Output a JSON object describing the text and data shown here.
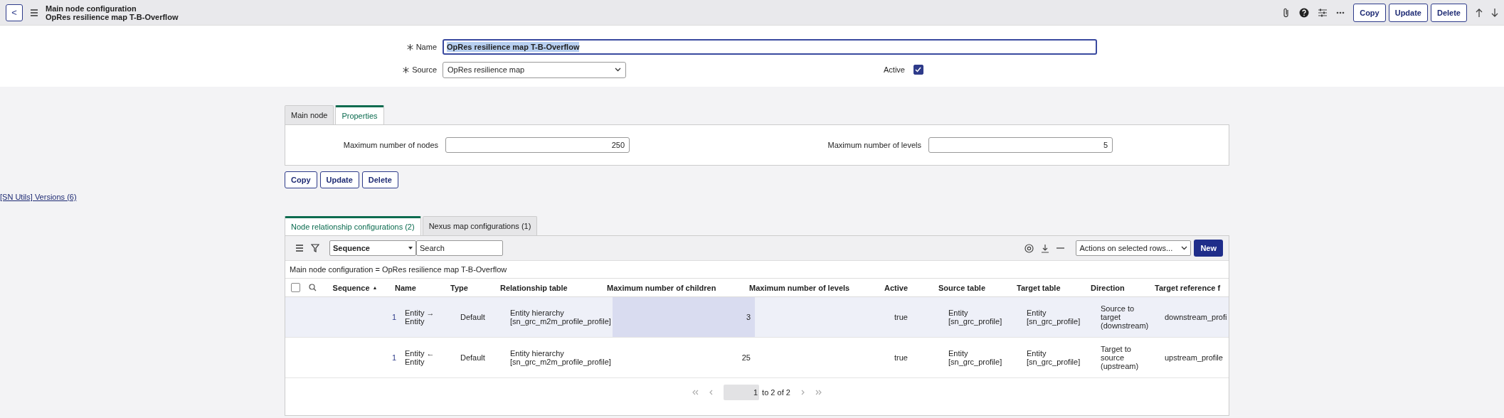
{
  "header": {
    "back": "<",
    "title": "Main node configuration",
    "subtitle": "OpRes resilience map T-B-Overflow",
    "buttons": [
      "Copy",
      "Update",
      "Delete"
    ]
  },
  "form": {
    "name_label": "Name",
    "name_value": "OpRes resilience map T-B-Overflow",
    "source_label": "Source",
    "source_value": "OpRes resilience map",
    "active_label": "Active",
    "active_checked": true
  },
  "tabs": [
    {
      "label": "Main node",
      "selected": false
    },
    {
      "label": "Properties",
      "selected": true
    }
  ],
  "properties": {
    "nodes_label": "Maximum number of nodes",
    "nodes_value": "250",
    "levels_label": "Maximum number of levels",
    "levels_value": "5"
  },
  "form_buttons": [
    "Copy",
    "Update",
    "Delete"
  ],
  "versions_link": "[SN Utils] Versions (6)",
  "related_tabs": [
    {
      "label": "Node relationship configurations (2)",
      "selected": true
    },
    {
      "label": "Nexus map configurations (1)",
      "selected": false
    }
  ],
  "list": {
    "field_select": "Sequence",
    "search_placeholder": "Search",
    "actions_select": "Actions on selected rows...",
    "new_button": "New",
    "breadcrumb": "Main node configuration = OpRes resilience map T-B-Overflow",
    "columns": [
      "Sequence",
      "Name",
      "Type",
      "Relationship table",
      "Maximum number of children",
      "Maximum number of levels",
      "Active",
      "Source table",
      "Target table",
      "Direction",
      "Target reference f"
    ],
    "sort_indicator": "▲",
    "select_all_checked": false,
    "rows": [
      {
        "highlighted": true,
        "cells": [
          {
            "text": "1",
            "selected": false
          },
          {
            "text": "Entity → Entity",
            "selected": false
          },
          {
            "text": "Default",
            "selected": false
          },
          {
            "text": "Entity hierarchy [sn_grc_m2m_profile_profile]",
            "selected": false
          },
          {
            "text": "3",
            "selected": true
          },
          {
            "selected": false
          },
          {
            "text": "true",
            "selected": false
          },
          {
            "text": "Entity [sn_grc_profile]",
            "selected": false
          },
          {
            "text": "Entity [sn_grc_profile]",
            "selected": false
          },
          {
            "text": "Source to target (downstream)",
            "selected": false
          },
          {
            "text": "downstream_profi",
            "selected": false
          }
        ]
      },
      {
        "highlighted": false,
        "cells": [
          {
            "text": "1",
            "selected": false
          },
          {
            "text": "Entity ← Entity",
            "selected": false
          },
          {
            "text": "Default",
            "selected": false
          },
          {
            "text": "Entity hierarchy [sn_grc_m2m_profile_profile]",
            "selected": false
          },
          {
            "text": "25",
            "selected": false
          },
          {
            "selected": false
          },
          {
            "text": "true",
            "selected": false
          },
          {
            "text": "Entity [sn_grc_profile]",
            "selected": false
          },
          {
            "text": "Entity [sn_grc_profile]",
            "selected": false
          },
          {
            "text": "Target to source (upstream)",
            "selected": false
          },
          {
            "text": "upstream_profile",
            "selected": false
          }
        ]
      }
    ],
    "pager": {
      "page": "1",
      "range": "to 2 of 2"
    }
  }
}
